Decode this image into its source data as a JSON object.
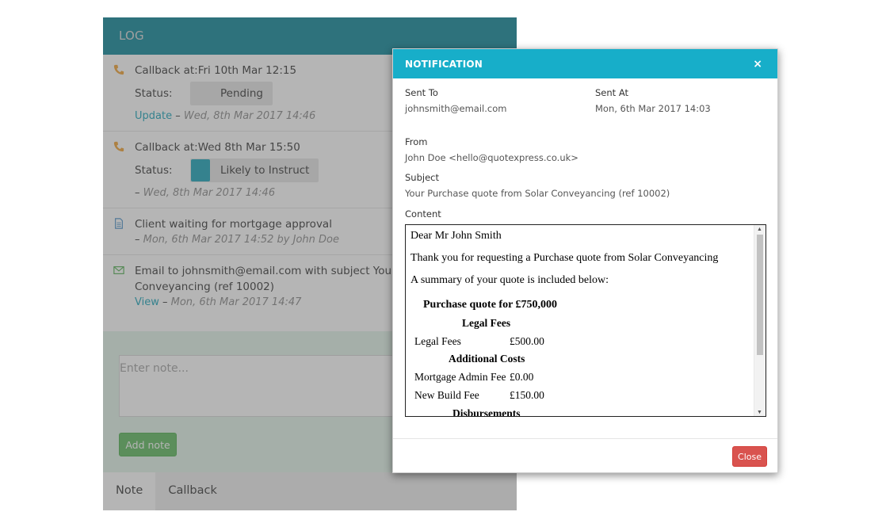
{
  "log": {
    "title": "LOG",
    "entries": [
      {
        "icon": "phone-icon",
        "text": "Callback at:Fri 10th Mar 12:15",
        "status_label": "Status:",
        "status": "Pending",
        "link": "Update",
        "separator": "–",
        "timestamp": "Wed, 8th Mar 2017 14:46"
      },
      {
        "icon": "phone-icon",
        "text": "Callback at:Wed 8th Mar 15:50",
        "status_label": "Status:",
        "status": "Likely to Instruct",
        "status_color": "#17a2b8",
        "separator": "–",
        "timestamp": "Wed, 8th Mar 2017 14:46"
      },
      {
        "icon": "document-icon",
        "text": "Client waiting for mortgage approval",
        "separator": "–",
        "timestamp": "Mon, 6th Mar 2017 14:52 by John Doe"
      },
      {
        "icon": "envelope-icon",
        "text_line1": "Email to johnsmith@email.com with subject Your Purc",
        "text_line2": "Conveyancing (ref 10002)",
        "link": "View",
        "separator": "–",
        "timestamp": "Mon, 6th Mar 2017 14:47"
      }
    ],
    "note_placeholder": "Enter note...",
    "add_note_label": "Add note",
    "tabs": [
      "Note",
      "Callback"
    ]
  },
  "modal": {
    "title": "NOTIFICATION",
    "close_x": "×",
    "sent_to_label": "Sent To",
    "sent_to": "johnsmith@email.com",
    "sent_at_label": "Sent At",
    "sent_at": "Mon, 6th Mar 2017 14:03",
    "from_label": "From",
    "from": "John Doe <hello@quotexpress.co.uk>",
    "subject_label": "Subject",
    "subject": "Your Purchase quote from Solar Conveyancing (ref 10002)",
    "content_label": "Content",
    "email": {
      "greeting": "Dear Mr John Smith",
      "intro": "Thank you for requesting a Purchase quote from Solar Conveyancing",
      "summary": "A summary of your quote is included below:",
      "quote_title": "Purchase quote for £750,000",
      "legal_fees_heading": "Legal Fees",
      "rows": [
        {
          "label": "Legal Fees",
          "value": "£500.00"
        }
      ],
      "additional_heading": "Additional Costs",
      "additional_rows": [
        {
          "label": "Mortgage Admin Fee",
          "value": "£0.00"
        },
        {
          "label": "New Build Fee",
          "value": "£150.00"
        }
      ],
      "disbursements_heading": "Disbursements"
    },
    "close_button": "Close"
  },
  "colors": {
    "header_teal": "#17a2b8",
    "link_teal": "#17a2b8",
    "close_red": "#d9534f",
    "add_note_green": "#5cb85c"
  }
}
